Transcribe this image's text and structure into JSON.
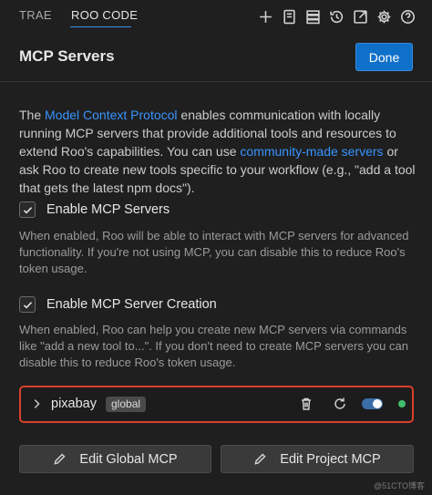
{
  "tabs": {
    "trae": "TRAE",
    "roo": "ROO CODE"
  },
  "toolbar_icons": [
    "plus-icon",
    "history-panel-icon",
    "server-stack-icon",
    "clock-history-icon",
    "external-open-icon",
    "gear-icon",
    "help-icon"
  ],
  "header": {
    "title": "MCP Servers",
    "done_label": "Done"
  },
  "intro": {
    "t1": "The ",
    "link1": "Model Context Protocol",
    "t2": " enables communication with locally running MCP servers that provide additional tools and resources to extend Roo's capabilities. You can use ",
    "link2": "community-made servers",
    "t3": " or ask Roo to create new tools specific to your workflow (e.g., \"add a tool that gets the latest npm docs\")."
  },
  "settings": {
    "enable_mcp": {
      "label": "Enable MCP Servers",
      "checked": true,
      "description": "When enabled, Roo will be able to interact with MCP servers for advanced functionality. If you're not using MCP, you can disable this to reduce Roo's token usage."
    },
    "enable_creation": {
      "label": "Enable MCP Server Creation",
      "checked": true,
      "description": "When enabled, Roo can help you create new MCP servers via commands like \"add a new tool to...\". If you don't need to create MCP servers you can disable this to reduce Roo's token usage."
    }
  },
  "server": {
    "name": "pixabay",
    "badge": "global",
    "enabled": true,
    "status_color": "#3fbf6b",
    "highlight_color": "#d9402c"
  },
  "buttons": {
    "edit_global": "Edit Global MCP",
    "edit_project": "Edit Project MCP"
  },
  "watermark": "@51CTO博客",
  "colors": {
    "accent": "#0e70c8",
    "link": "#3794ff"
  }
}
